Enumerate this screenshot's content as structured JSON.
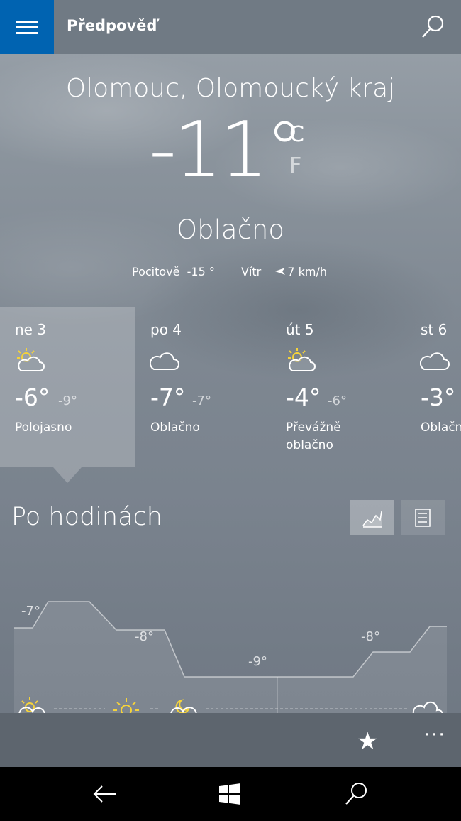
{
  "app": {
    "title": "Předpověď"
  },
  "current": {
    "location": "Olomouc, Olomoucký kraj",
    "temperature": "-11°",
    "unit_c": "C",
    "unit_f": "F",
    "condition": "Oblačno",
    "feels_label": "Pocitově",
    "feels_value": "-15 °",
    "wind_label": "Vítr",
    "wind_value": "7 km/h"
  },
  "days": [
    {
      "name": "ne 3",
      "hi": "-6°",
      "lo": "-9°",
      "desc_line1": "Polojasno",
      "desc_line2": "",
      "icon": "partly-sunny-icon",
      "selected": true
    },
    {
      "name": "po 4",
      "hi": "-7°",
      "lo": "-7°",
      "desc_line1": "Oblačno",
      "desc_line2": "",
      "icon": "cloud-icon",
      "selected": false
    },
    {
      "name": "út 5",
      "hi": "-4°",
      "lo": "-6°",
      "desc_line1": "Převážně",
      "desc_line2": "oblačno",
      "icon": "partly-sunny-icon",
      "selected": false
    },
    {
      "name": "st 6",
      "hi": "-3°",
      "lo": "",
      "desc_line1": "Oblačn",
      "desc_line2": "",
      "icon": "cloud-icon",
      "selected": false
    }
  ],
  "hourly": {
    "title": "Po hodinách",
    "chart_view_icon": "line-chart-icon",
    "list_view_icon": "list-icon",
    "temps": [
      {
        "label": "-7°"
      },
      {
        "label": "-8°"
      },
      {
        "label": "-9°"
      },
      {
        "label": "-8°"
      }
    ]
  },
  "bottom": {
    "favorite_icon": "star-icon",
    "favorite_glyph": "★",
    "more_glyph": "···"
  },
  "colors": {
    "accent": "#0063b1",
    "topbar": "#707a84",
    "bottombar": "#5d656e"
  }
}
